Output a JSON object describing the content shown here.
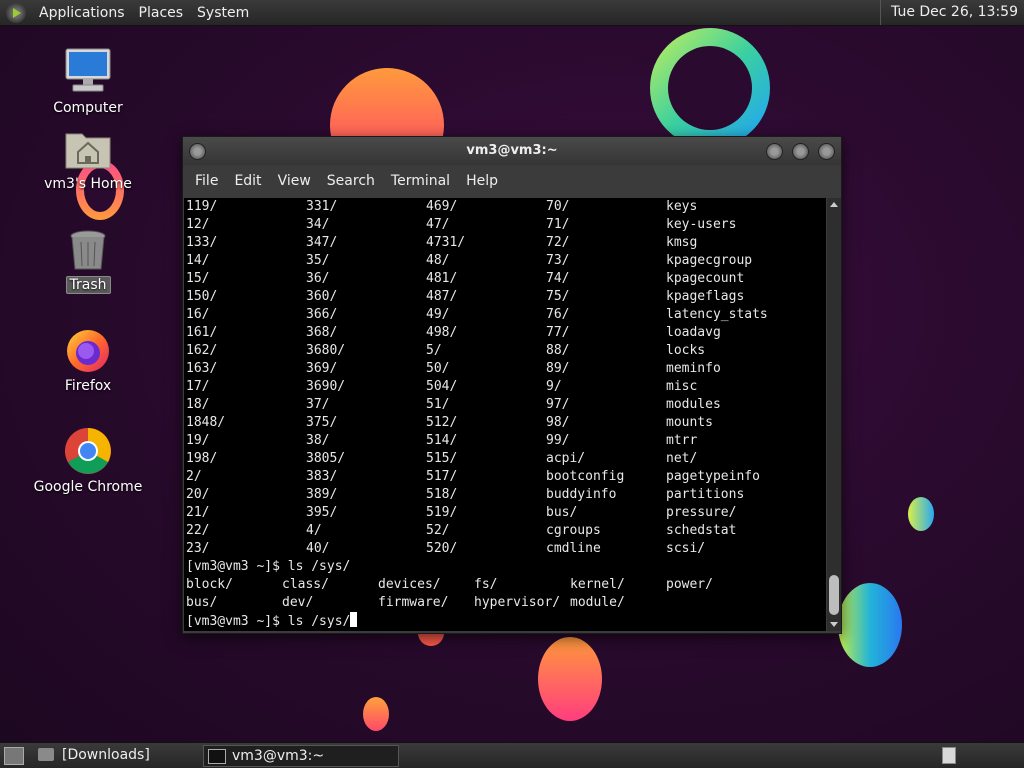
{
  "top_panel": {
    "menus": [
      "Applications",
      "Places",
      "System"
    ],
    "clock": "Tue Dec 26, 13:59"
  },
  "desktop": {
    "icons": [
      {
        "label": "Computer",
        "icon": "computer-icon"
      },
      {
        "label": "vm3's Home",
        "icon": "home-folder-icon"
      },
      {
        "label": "Trash",
        "icon": "trash-icon"
      },
      {
        "label": "Firefox",
        "icon": "firefox-icon"
      },
      {
        "label": "Google Chrome",
        "icon": "chrome-icon"
      }
    ]
  },
  "terminal": {
    "title": "vm3@vm3:~",
    "menus": [
      "File",
      "Edit",
      "View",
      "Search",
      "Terminal",
      "Help"
    ],
    "proc_rows": [
      [
        "119/",
        "331/",
        "469/",
        "70/",
        "keys"
      ],
      [
        "12/",
        "34/",
        "47/",
        "71/",
        "key-users"
      ],
      [
        "133/",
        "347/",
        "4731/",
        "72/",
        "kmsg"
      ],
      [
        "14/",
        "35/",
        "48/",
        "73/",
        "kpagecgroup"
      ],
      [
        "15/",
        "36/",
        "481/",
        "74/",
        "kpagecount"
      ],
      [
        "150/",
        "360/",
        "487/",
        "75/",
        "kpageflags"
      ],
      [
        "16/",
        "366/",
        "49/",
        "76/",
        "latency_stats"
      ],
      [
        "161/",
        "368/",
        "498/",
        "77/",
        "loadavg"
      ],
      [
        "162/",
        "3680/",
        "5/",
        "88/",
        "locks"
      ],
      [
        "163/",
        "369/",
        "50/",
        "89/",
        "meminfo"
      ],
      [
        "17/",
        "3690/",
        "504/",
        "9/",
        "misc"
      ],
      [
        "18/",
        "37/",
        "51/",
        "97/",
        "modules"
      ],
      [
        "1848/",
        "375/",
        "512/",
        "98/",
        "mounts"
      ],
      [
        "19/",
        "38/",
        "514/",
        "99/",
        "mtrr"
      ],
      [
        "198/",
        "3805/",
        "515/",
        "acpi/",
        "net/"
      ],
      [
        "2/",
        "383/",
        "517/",
        "bootconfig",
        "pagetypeinfo"
      ],
      [
        "20/",
        "389/",
        "518/",
        "buddyinfo",
        "partitions"
      ],
      [
        "21/",
        "395/",
        "519/",
        "bus/",
        "pressure/"
      ],
      [
        "22/",
        "4/",
        "52/",
        "cgroups",
        "schedstat"
      ],
      [
        "23/",
        "40/",
        "520/",
        "cmdline",
        "scsi/"
      ]
    ],
    "prompt1": "[vm3@vm3 ~]$ ls /sys/",
    "sys_rows": [
      [
        "block/",
        "class/",
        "devices/",
        "fs/",
        "kernel/",
        "power/"
      ],
      [
        "bus/",
        "dev/",
        "firmware/",
        "hypervisor/",
        "module/",
        ""
      ]
    ],
    "prompt2": "[vm3@vm3 ~]$ ls /sys/"
  },
  "bottom_panel": {
    "tasks": [
      {
        "label": "[Downloads]",
        "icon": "folder-icon"
      },
      {
        "label": "vm3@vm3:~",
        "icon": "terminal-icon"
      }
    ]
  }
}
